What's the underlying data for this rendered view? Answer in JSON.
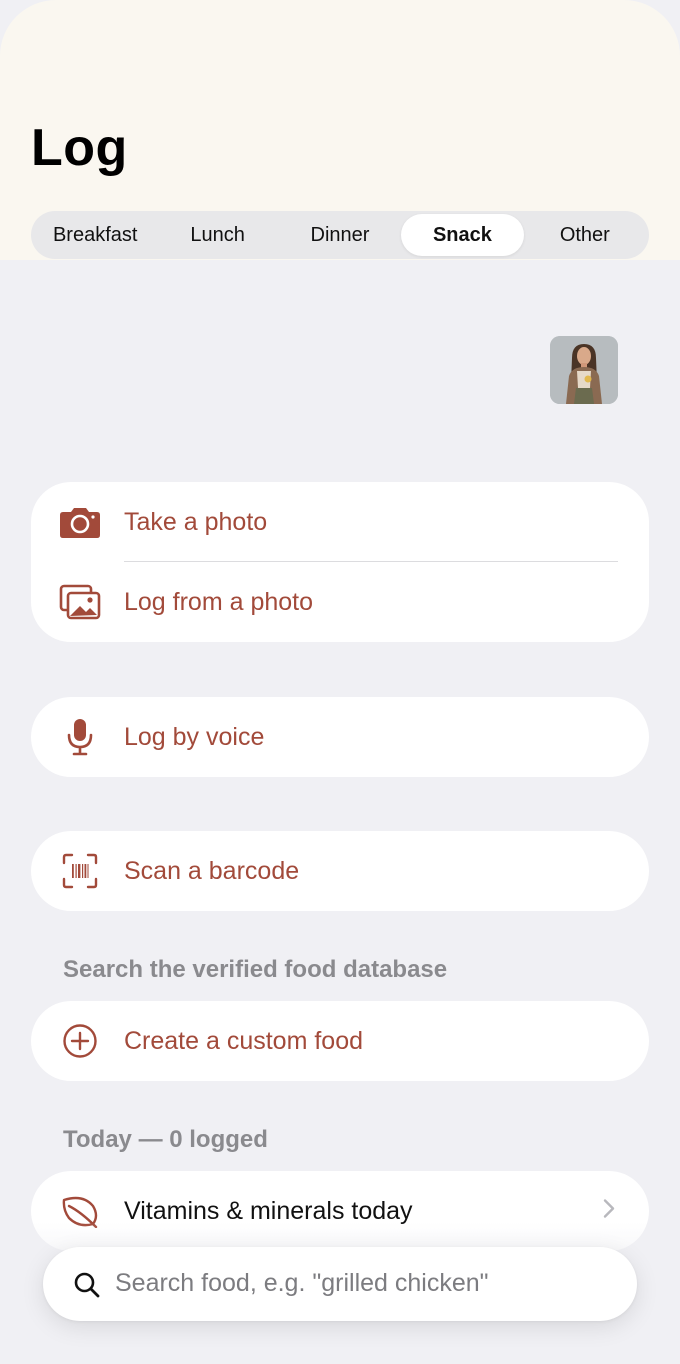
{
  "header": {
    "title": "Log"
  },
  "meal_tabs": [
    {
      "label": "Breakfast",
      "selected": false
    },
    {
      "label": "Lunch",
      "selected": false
    },
    {
      "label": "Dinner",
      "selected": false
    },
    {
      "label": "Snack",
      "selected": true
    },
    {
      "label": "Other",
      "selected": false
    }
  ],
  "photo_card": {
    "take_photo": "Take a photo",
    "log_from_photo": "Log from a photo"
  },
  "voice": {
    "label": "Log by voice"
  },
  "barcode": {
    "label": "Scan a barcode"
  },
  "database": {
    "section_label": "Search the verified food database",
    "create_custom": "Create a custom food"
  },
  "today": {
    "section_label": "Today — 0 logged",
    "vitamins": "Vitamins & minerals today"
  },
  "search": {
    "placeholder": "Search food, e.g. \"grilled chicken\""
  },
  "colors": {
    "accent": "#a24a3a",
    "background": "#f0f0f4",
    "header_bg": "#faf7f0"
  },
  "icons": [
    "camera-icon",
    "photo-library-icon",
    "microphone-icon",
    "barcode-scan-icon",
    "plus-circle-icon",
    "leaf-icon",
    "chevron-right-icon",
    "search-icon"
  ]
}
